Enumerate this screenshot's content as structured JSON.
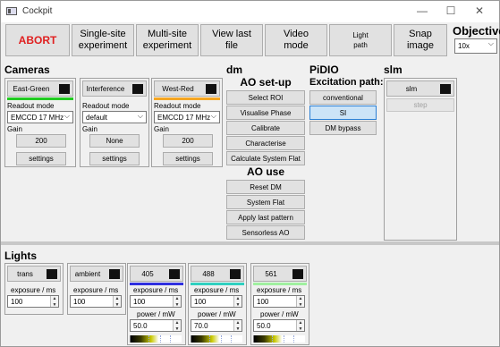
{
  "window": {
    "title": "Cockpit",
    "controls": {
      "minimize": "—",
      "maximize": "☐",
      "close": "✕"
    }
  },
  "toolbar": {
    "abort": "ABORT",
    "single_site": "Single-site\nexperiment",
    "multi_site": "Multi-site\nexperiment",
    "view_last": "View last\nfile",
    "video_mode": "Video\nmode",
    "light_path": "Light\npath",
    "snap_image": "Snap\nimage",
    "objective_title": "Objective",
    "objective_value": "10x"
  },
  "cameras": {
    "title": "Cameras",
    "readout_label": "Readout mode",
    "gain_label": "Gain",
    "settings_label": "settings",
    "items": [
      {
        "name": "East-Green",
        "color": "#22cc22",
        "readout": "EMCCD 17 MHz",
        "gain": "200"
      },
      {
        "name": "Interference",
        "color": "#f0f0f0",
        "readout": "default",
        "gain": "None"
      },
      {
        "name": "West-Red",
        "color": "#f5a623",
        "readout": "EMCCD 17 MHz",
        "gain": "200"
      }
    ]
  },
  "dm": {
    "title": "dm",
    "ao_setup_title": "AO set-up",
    "setup_buttons": [
      "Select ROI",
      "Visualise Phase",
      "Calibrate",
      "Characterise",
      "Calculate System Flat"
    ],
    "ao_use_title": "AO use",
    "use_buttons": [
      "Reset DM",
      "System Flat",
      "Apply last pattern",
      "Sensorless AO"
    ]
  },
  "pidio": {
    "title": "PiDIO",
    "excitation_title": "Excitation path:",
    "options": [
      "conventional",
      "SI",
      "DM bypass"
    ],
    "selected": "SI"
  },
  "slm": {
    "title": "slm",
    "toggle_label": "slm",
    "step_label": "step"
  },
  "lights": {
    "title": "Lights",
    "exposure_label": "exposure / ms",
    "power_label": "power / mW",
    "items": [
      {
        "name": "trans",
        "color": "",
        "exposure": "100"
      },
      {
        "name": "ambient",
        "color": "",
        "exposure": "100"
      },
      {
        "name": "405",
        "color": "#3030e0",
        "exposure": "100",
        "power": "50.0"
      },
      {
        "name": "488",
        "color": "#30d0c0",
        "exposure": "100",
        "power": "70.0"
      },
      {
        "name": "561",
        "color": "#a0f0a0",
        "exposure": "100",
        "power": "50.0"
      }
    ]
  }
}
